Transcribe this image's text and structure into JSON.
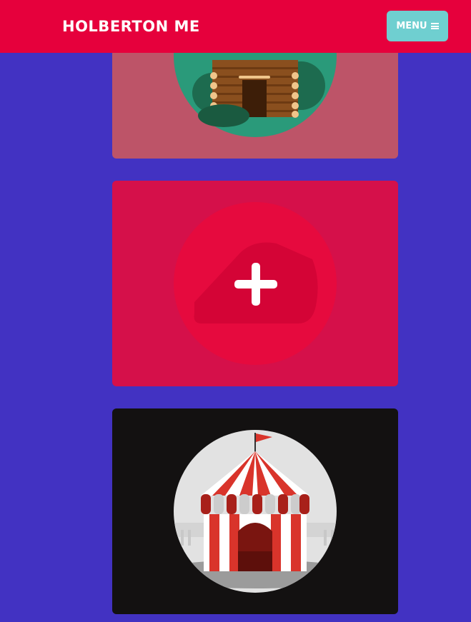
{
  "header": {
    "brand": "HOLBERTON ME",
    "menu_label": "MENU",
    "menu_icon": "bars-icon"
  },
  "portfolio": {
    "items": [
      {
        "image": "log-cabin-illustration",
        "state": "default"
      },
      {
        "image": "sled-illustration",
        "state": "hover",
        "overlay_icon": "plus-icon"
      },
      {
        "image": "circus-tent-illustration",
        "state": "default"
      }
    ]
  },
  "colors": {
    "navbar": "#e6003c",
    "page_background": "#4232c2",
    "menu_button": "#6fcfd0",
    "card_hover": "#d5104a"
  }
}
